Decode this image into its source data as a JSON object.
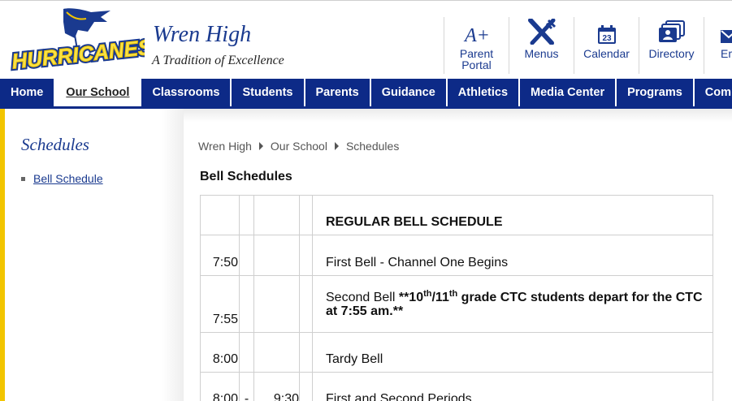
{
  "header": {
    "logo_text": "HURRICANES",
    "school_name": "Wren High",
    "tagline": "A Tradition of Excellence"
  },
  "quicklinks": [
    {
      "label1": "Parent",
      "label2": "Portal",
      "icon": "a-plus-icon"
    },
    {
      "label1": "Menus",
      "label2": "",
      "icon": "fork-knife-icon"
    },
    {
      "label1": "Calendar",
      "label2": "",
      "icon": "calendar-icon",
      "icon_text": "23"
    },
    {
      "label1": "Directory",
      "label2": "",
      "icon": "directory-icon"
    },
    {
      "label1": "Em",
      "label2": "",
      "icon": "envelope-icon"
    }
  ],
  "nav": [
    {
      "label": "Home"
    },
    {
      "label": "Our School",
      "active": true
    },
    {
      "label": "Classrooms"
    },
    {
      "label": "Students"
    },
    {
      "label": "Parents"
    },
    {
      "label": "Guidance"
    },
    {
      "label": "Athletics"
    },
    {
      "label": "Media Center"
    },
    {
      "label": "Programs"
    },
    {
      "label": "Community"
    }
  ],
  "sidebar": {
    "title": "Schedules",
    "links": [
      {
        "label": "Bell Schedule"
      }
    ]
  },
  "breadcrumb": [
    "Wren High",
    "Our School",
    "Schedules"
  ],
  "page_title": "Bell Schedules",
  "schedule": {
    "heading": "REGULAR BELL SCHEDULE",
    "rows": [
      {
        "start": "7:50",
        "dash": "",
        "end": "",
        "desc": "First Bell - Channel One Begins"
      },
      {
        "start": "7:55",
        "dash": "",
        "end": "",
        "desc_prefix": "Second Bell ",
        "desc_bold_a": "**10",
        "sup1": "th",
        "desc_bold_b": "/11",
        "sup2": "th",
        "desc_bold_c": " grade CTC students depart for the CTC at 7:55 am.**"
      },
      {
        "start": "8:00",
        "dash": "",
        "end": "",
        "desc": "Tardy Bell"
      },
      {
        "start": "8:00",
        "dash": "-",
        "end": "9:30",
        "desc": "First and Second Periods"
      }
    ]
  },
  "colors": {
    "brand_blue": "#0d2a87",
    "title_blue": "#1a3a8f",
    "gold": "#f2c500"
  }
}
